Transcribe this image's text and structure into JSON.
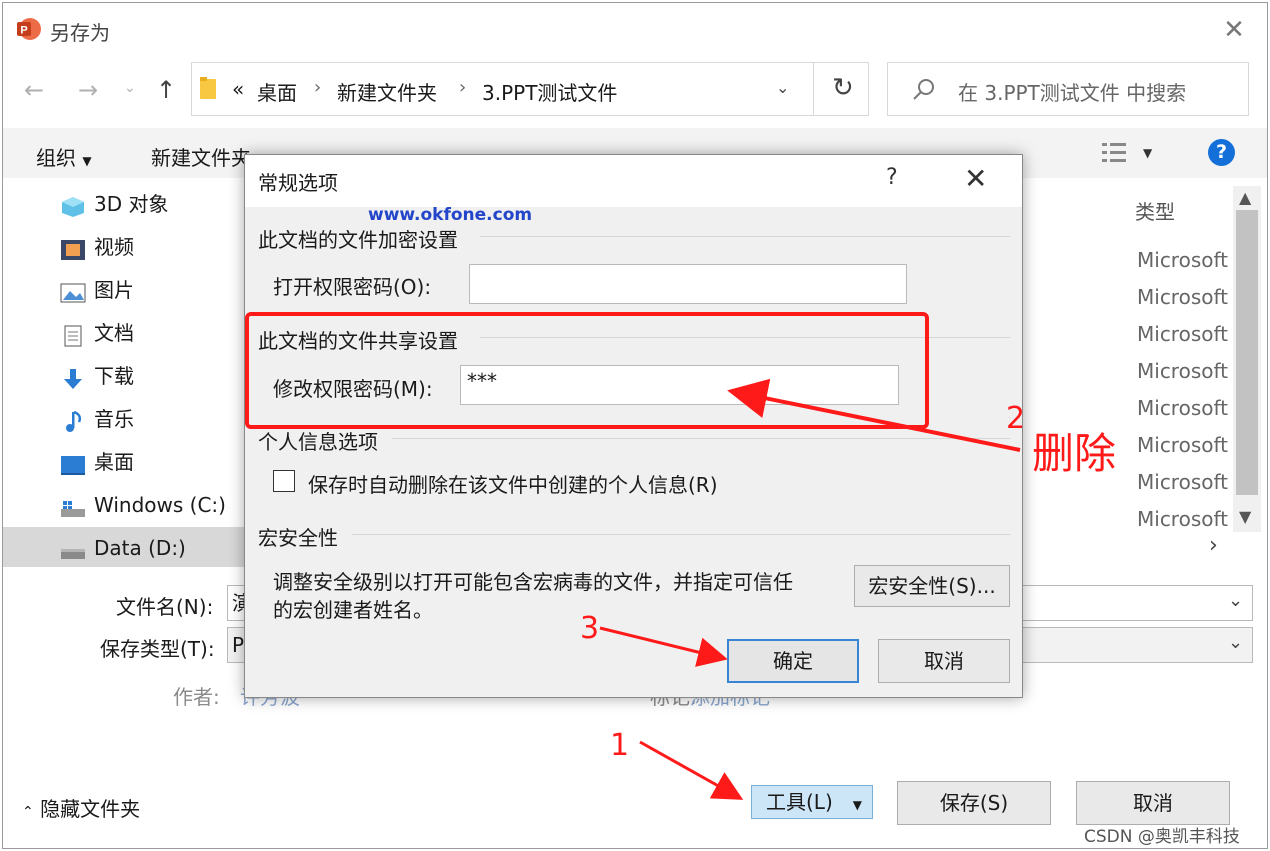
{
  "window": {
    "title": "另存为",
    "breadcrumb": [
      "桌面",
      "新建文件夹",
      "3.PPT测试文件"
    ],
    "breadcrumb_prefix": "«",
    "search_placeholder": "在 3.PPT测试文件 中搜索"
  },
  "toolbar": {
    "organize": "组织",
    "new_folder": "新建文件夹"
  },
  "sidebar": {
    "items": [
      {
        "label": "3D 对象",
        "icon": "3d-objects-icon"
      },
      {
        "label": "视频",
        "icon": "video-icon"
      },
      {
        "label": "图片",
        "icon": "pictures-icon"
      },
      {
        "label": "文档",
        "icon": "documents-icon"
      },
      {
        "label": "下载",
        "icon": "download-icon"
      },
      {
        "label": "音乐",
        "icon": "music-icon"
      },
      {
        "label": "桌面",
        "icon": "desktop-icon"
      },
      {
        "label": "Windows (C:)",
        "icon": "drive-c-icon"
      },
      {
        "label": "Data (D:)",
        "icon": "drive-d-icon",
        "selected": true
      }
    ]
  },
  "file_list": {
    "column_type": "类型",
    "items": [
      "Microsoft",
      "Microsoft",
      "Microsoft",
      "Microsoft",
      "Microsoft",
      "Microsoft",
      "Microsoft",
      "Microsoft"
    ]
  },
  "form": {
    "filename_label": "文件名(N):",
    "filename_value": "演",
    "savetype_label": "保存类型(T):",
    "savetype_value": "P",
    "author_label": "作者:",
    "author_value": "许芳波",
    "tags_label": "标记:",
    "tags_value": "添加标记"
  },
  "footer": {
    "hide_folders": "隐藏文件夹",
    "tools": "工具(L)",
    "save": "保存(S)",
    "cancel": "取消"
  },
  "dialog": {
    "title": "常规选项",
    "help": "?",
    "watermark": "www.okfone.com",
    "encrypt_section": "此文档的文件加密设置",
    "open_password_label": "打开权限密码(O):",
    "open_password_value": "",
    "share_section": "此文档的文件共享设置",
    "modify_password_label": "修改权限密码(M):",
    "modify_password_value": "***",
    "privacy_section": "个人信息选项",
    "privacy_checkbox_label": "保存时自动删除在该文件中创建的个人信息(R)",
    "macro_section": "宏安全性",
    "macro_text_line1": "调整安全级别以打开可能包含宏病毒的文件，并指定可信任",
    "macro_text_line2": "的宏创建者姓名。",
    "macro_button": "宏安全性(S)...",
    "ok": "确定",
    "cancel": "取消"
  },
  "annotations": {
    "step1": "1",
    "step2": "2",
    "step3": "3",
    "delete_label": "删除"
  },
  "credit": "CSDN @奥凯丰科技",
  "colors": {
    "accent": "#1470d8",
    "annotation_red": "#ff1a1a",
    "watermark_blue": "#2345c9"
  }
}
